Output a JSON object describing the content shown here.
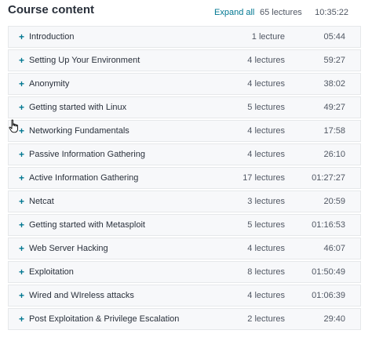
{
  "header": {
    "title": "Course content",
    "expand_all": "Expand all",
    "total_lectures": "65 lectures",
    "total_time": "10:35:22"
  },
  "sections": [
    {
      "name": "Introduction",
      "lectures": "1 lecture",
      "duration": "05:44"
    },
    {
      "name": "Setting Up Your Environment",
      "lectures": "4 lectures",
      "duration": "59:27"
    },
    {
      "name": "Anonymity",
      "lectures": "4 lectures",
      "duration": "38:02"
    },
    {
      "name": "Getting started with Linux",
      "lectures": "5 lectures",
      "duration": "49:27"
    },
    {
      "name": "Networking Fundamentals",
      "lectures": "4 lectures",
      "duration": "17:58"
    },
    {
      "name": "Passive Information Gathering",
      "lectures": "4 lectures",
      "duration": "26:10"
    },
    {
      "name": "Active Information Gathering",
      "lectures": "17 lectures",
      "duration": "01:27:27"
    },
    {
      "name": "Netcat",
      "lectures": "3 lectures",
      "duration": "20:59"
    },
    {
      "name": "Getting started with Metasploit",
      "lectures": "5 lectures",
      "duration": "01:16:53"
    },
    {
      "name": "Web Server Hacking",
      "lectures": "4 lectures",
      "duration": "46:07"
    },
    {
      "name": "Exploitation",
      "lectures": "8 lectures",
      "duration": "01:50:49"
    },
    {
      "name": "Wired and WIreless attacks",
      "lectures": "4 lectures",
      "duration": "01:06:39"
    },
    {
      "name": "Post Exploitation & Privilege Escalation",
      "lectures": "2 lectures",
      "duration": "29:40"
    }
  ],
  "icons": {
    "expand": "plus-icon",
    "cursor": "hand-pointer-icon"
  },
  "colors": {
    "accent": "#007791",
    "row_bg": "#f7f8fa",
    "row_border": "#e6e8ea",
    "text": "#29303b",
    "muted": "#505763"
  }
}
